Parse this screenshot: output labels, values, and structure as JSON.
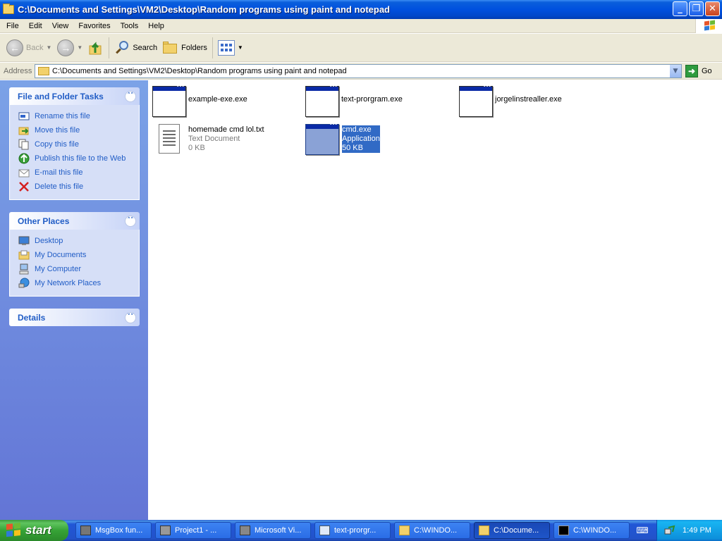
{
  "window": {
    "title": "C:\\Documents and Settings\\VM2\\Desktop\\Random programs using paint and notepad",
    "buttons": {
      "minimize": "_",
      "maximize": "❐",
      "close": "✕"
    }
  },
  "menu": [
    "File",
    "Edit",
    "View",
    "Favorites",
    "Tools",
    "Help"
  ],
  "toolbar": {
    "back": "Back",
    "search": "Search",
    "folders": "Folders"
  },
  "address": {
    "label": "Address",
    "value": "C:\\Documents and Settings\\VM2\\Desktop\\Random programs using paint and notepad",
    "go": "Go"
  },
  "taskpane": {
    "file_tasks": {
      "title": "File and Folder Tasks",
      "items": [
        {
          "label": "Rename this file",
          "icon": "rename-icon"
        },
        {
          "label": "Move this file",
          "icon": "move-icon"
        },
        {
          "label": "Copy this file",
          "icon": "copy-icon"
        },
        {
          "label": "Publish this file to the Web",
          "icon": "publish-web-icon"
        },
        {
          "label": "E-mail this file",
          "icon": "email-icon"
        },
        {
          "label": "Delete this file",
          "icon": "delete-icon"
        }
      ]
    },
    "other_places": {
      "title": "Other Places",
      "items": [
        {
          "label": "Desktop",
          "icon": "desktop-icon"
        },
        {
          "label": "My Documents",
          "icon": "my-documents-icon"
        },
        {
          "label": "My Computer",
          "icon": "my-computer-icon"
        },
        {
          "label": "My Network Places",
          "icon": "network-places-icon"
        }
      ]
    },
    "details": {
      "title": "Details"
    }
  },
  "files": [
    {
      "name": "example-exe.exe"
    },
    {
      "name": "text-prorgram.exe"
    },
    {
      "name": "jorgelinstrealler.exe"
    },
    {
      "name": "homemade cmd lol.txt",
      "type": "Text Document",
      "size": "0 KB"
    },
    {
      "name": "cmd.exe",
      "type": "Application",
      "size": "50 KB",
      "selected": true
    }
  ],
  "taskbar": {
    "start": "start",
    "buttons": [
      {
        "label": "MsgBox fun..."
      },
      {
        "label": "Project1 - ..."
      },
      {
        "label": "Microsoft Vi..."
      },
      {
        "label": "text-prorgr..."
      },
      {
        "label": "C:\\WINDO..."
      },
      {
        "label": "C:\\Docume...",
        "active": true
      },
      {
        "label": "C:\\WINDO..."
      }
    ],
    "clock": "1:49 PM"
  }
}
